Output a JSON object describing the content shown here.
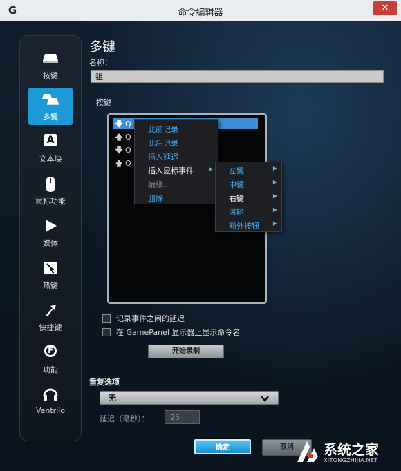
{
  "window": {
    "title": "命令编辑器",
    "close_glyph": "✕",
    "logo_glyph": "G"
  },
  "sidebar": {
    "items": [
      {
        "label": "按键",
        "icon": "key-icon"
      },
      {
        "label": "多键",
        "icon": "multikey-icon",
        "active": true
      },
      {
        "label": "文本块",
        "icon": "text-block-icon",
        "glyph": "A"
      },
      {
        "label": "鼠标功能",
        "icon": "mouse-icon"
      },
      {
        "label": "媒体",
        "icon": "play-icon"
      },
      {
        "label": "热键",
        "icon": "hotkey-icon"
      },
      {
        "label": "快捷键",
        "icon": "shortcut-arrow-icon"
      },
      {
        "label": "功能",
        "icon": "function-gear-icon",
        "glyph": "F"
      },
      {
        "label": "Ventrilo",
        "icon": "headset-icon"
      }
    ]
  },
  "main": {
    "heading": "多键",
    "name_label": "名称：",
    "name_value": "狙",
    "keys_label": "按键",
    "key_list": [
      {
        "direction": "down",
        "key": "Q"
      },
      {
        "direction": "up",
        "key": "Q"
      },
      {
        "direction": "down",
        "key": "Q"
      },
      {
        "direction": "up",
        "key": "Q"
      }
    ],
    "context_menu": [
      {
        "label": "此前记录",
        "state": "blue"
      },
      {
        "label": "此后记录",
        "state": "blue"
      },
      {
        "label": "插入延迟",
        "state": "blue"
      },
      {
        "label": "插入鼠标事件",
        "state": "white",
        "submenu": true
      },
      {
        "label": "编辑...",
        "state": "disabled"
      },
      {
        "label": "删除",
        "state": "blue"
      }
    ],
    "submenu": [
      {
        "label": "左键",
        "state": "blue"
      },
      {
        "label": "中键",
        "state": "blue"
      },
      {
        "label": "右键",
        "state": "white"
      },
      {
        "label": "滚轮",
        "state": "blue"
      },
      {
        "label": "额外按钮",
        "state": "blue"
      }
    ],
    "checkbox_delay": "记录事件之间的延迟",
    "checkbox_gamepanel": "在 GamePanel 显示器上显示命令名",
    "record_button": "开始录制",
    "repeat_label": "重复选项",
    "repeat_value": "无",
    "delay_label": "延迟（毫秒）：",
    "delay_value": "25",
    "ok_button": "确定",
    "cancel_button": "取消"
  },
  "watermark": {
    "title": "系统之家",
    "subtitle": "XITONGZHIJIA.NET"
  },
  "colors": {
    "accent_blue": "#1d9ad6",
    "menu_blue_text": "#46a8ea",
    "menu_disabled_text": "#8a8e93",
    "selected_row": "#3a8fd8"
  }
}
